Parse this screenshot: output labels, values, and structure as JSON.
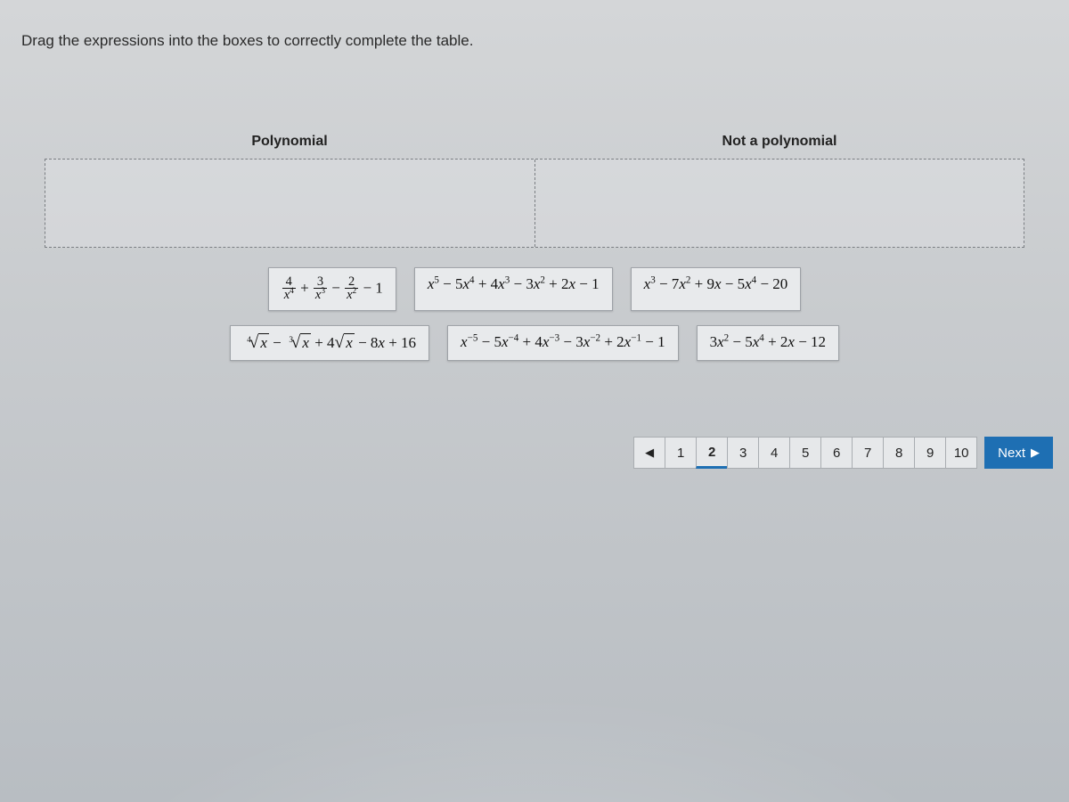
{
  "instruction": "Drag the expressions into the boxes to correctly complete the table.",
  "table": {
    "headers": [
      "Polynomial",
      "Not a polynomial"
    ]
  },
  "tiles": {
    "row1": [
      {
        "id": "tile-frac",
        "latex": "4/x^4 + 3/x^3 - 2/x^2 - 1"
      },
      {
        "id": "tile-poly5",
        "latex": "x^5 - 5x^4 + 4x^3 - 3x^2 + 2x - 1"
      },
      {
        "id": "tile-mixed-deg",
        "latex": "x^3 - 7x^2 + 9x - 5x^4 - 20"
      }
    ],
    "row2": [
      {
        "id": "tile-roots",
        "latex": "\\sqrt[4]{x} - \\sqrt[3]{x} + 4\\sqrt{x} - 8x + 16"
      },
      {
        "id": "tile-negexp",
        "latex": "x^{-5} - 5x^{-4} + 4x^{-3} - 3x^{-2} + 2x^{-1} - 1"
      },
      {
        "id": "tile-quad",
        "latex": "3x^2 - 5x^4 + 2x - 12"
      }
    ]
  },
  "pager": {
    "prev_glyph": "◀",
    "pages": [
      "1",
      "2",
      "3",
      "4",
      "5",
      "6",
      "7",
      "8",
      "9",
      "10"
    ],
    "current": "2",
    "next_label": "Next",
    "next_glyph": "▶"
  }
}
